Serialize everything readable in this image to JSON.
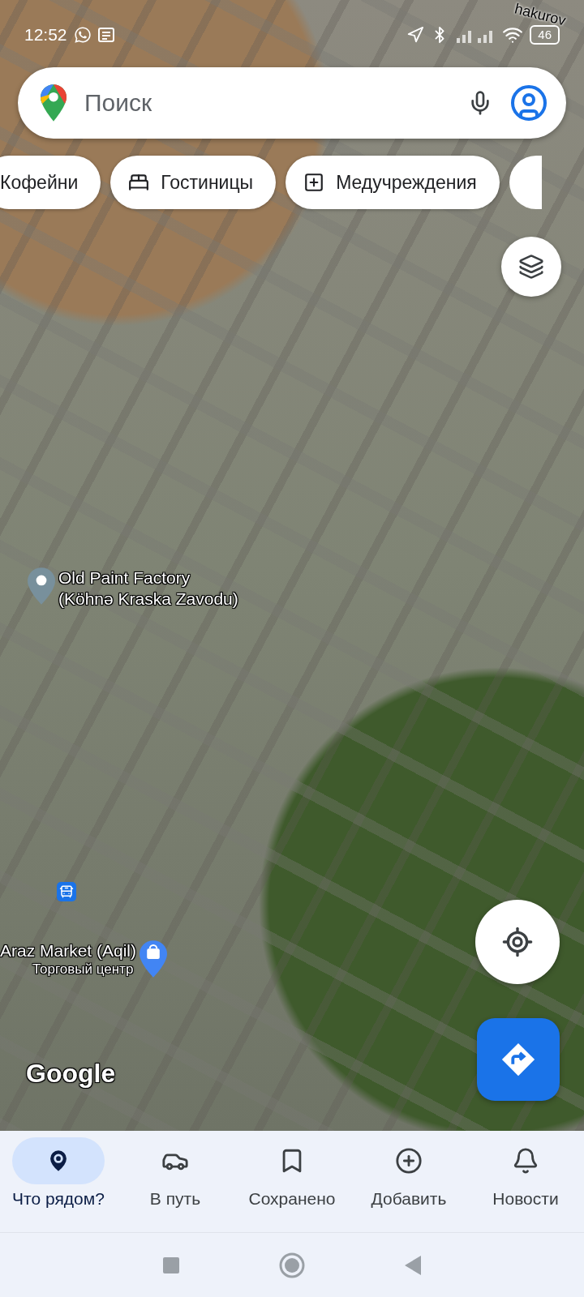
{
  "status_bar": {
    "time": "12:52",
    "battery": "46"
  },
  "search": {
    "placeholder": "Поиск"
  },
  "chips": [
    {
      "label": "Кофейни",
      "kind": "plain"
    },
    {
      "label": "Гостиницы",
      "kind": "hotel"
    },
    {
      "label": "Медучреждения",
      "kind": "medical"
    }
  ],
  "map": {
    "street_label": "hakurov",
    "places": [
      {
        "kind": "landmark",
        "lines": [
          "Old Paint Factory",
          "(Köhnə Kraska Zavodu)"
        ]
      },
      {
        "kind": "shopping",
        "lines": [
          "Araz Market (Aqil)"
        ],
        "subtitle": "Торговый центр"
      }
    ],
    "logo": "Google"
  },
  "nav": [
    {
      "label": "Что рядом?",
      "kind": "explore",
      "selected": true
    },
    {
      "label": "В путь",
      "kind": "commute",
      "selected": false
    },
    {
      "label": "Сохранено",
      "kind": "saved",
      "selected": false
    },
    {
      "label": "Добавить",
      "kind": "add",
      "selected": false
    },
    {
      "label": "Новости",
      "kind": "updates",
      "selected": false
    }
  ]
}
